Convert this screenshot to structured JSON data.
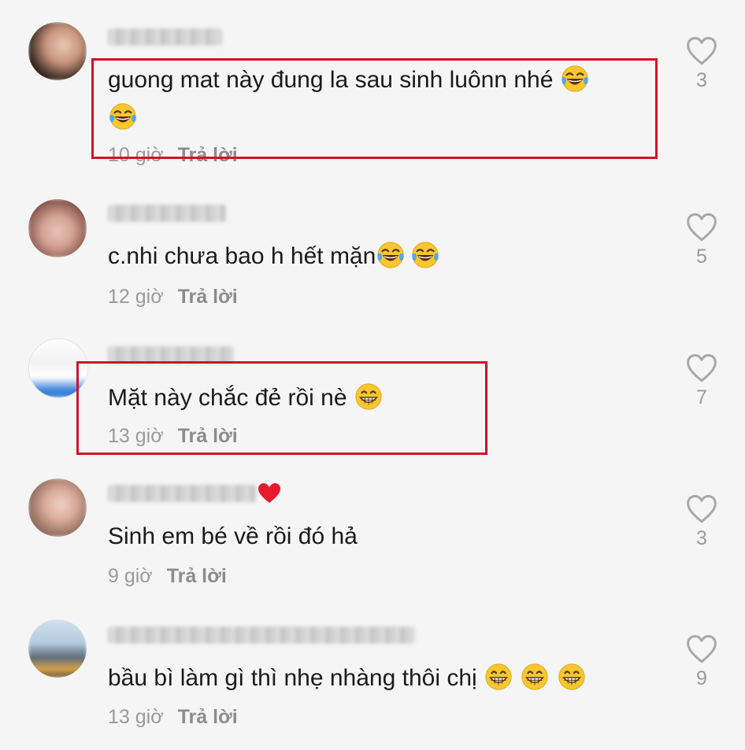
{
  "comments": [
    {
      "text": "guong mat này đung la sau sinh luônn nhé",
      "emojis": [
        "laughing-tears",
        "laughing-tears"
      ],
      "time": "10 giờ",
      "reply_label": "Trả lời",
      "likes": "3",
      "highlighted": true
    },
    {
      "text": "c.nhi chưa bao h hết mặn",
      "emojis": [
        "laughing-tears",
        "laughing-tears"
      ],
      "time": "12 giờ",
      "reply_label": "Trả lời",
      "likes": "5",
      "highlighted": false
    },
    {
      "text": "Mặt này chắc đẻ rồi nè",
      "emojis": [
        "grinning"
      ],
      "time": "13 giờ",
      "reply_label": "Trả lời",
      "likes": "7",
      "highlighted": true
    },
    {
      "text": "Sinh em bé về rồi đó hả",
      "emojis": [],
      "time": "9 giờ",
      "reply_label": "Trả lời",
      "likes": "3",
      "highlighted": false,
      "username_suffix_icon": "red-heart"
    },
    {
      "text": "bầu bì làm gì thì nhẹ nhàng thôi chị",
      "emojis": [
        "grinning",
        "grinning",
        "grinning"
      ],
      "time": "13 giờ",
      "reply_label": "Trả lời",
      "likes": "9",
      "highlighted": false
    }
  ],
  "colors": {
    "background": "#f5f5f5",
    "highlight_border": "#d4102b",
    "text": "#1a1a1a",
    "meta": "#9a9a9a"
  },
  "icons": {
    "like": "heart-outline-icon"
  }
}
